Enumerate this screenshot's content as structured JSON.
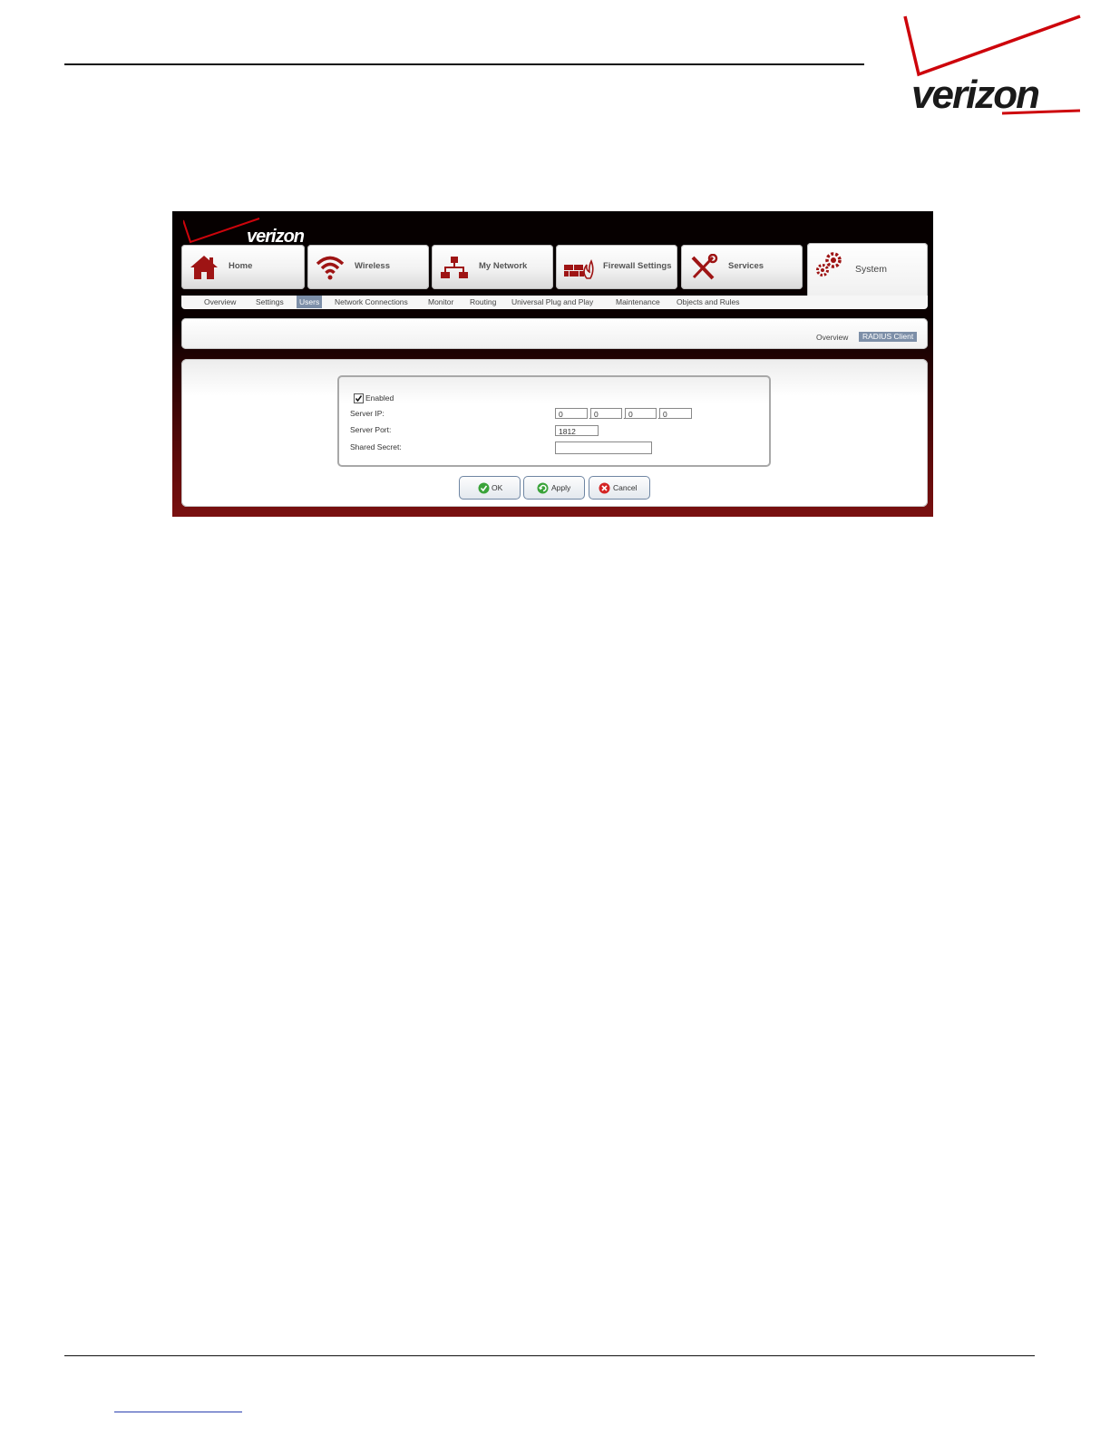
{
  "document": {
    "brand_logo_text": "verizon"
  },
  "router_ui": {
    "logo_text": "verizon",
    "main_tabs": [
      {
        "label": "Home",
        "icon": "home-icon"
      },
      {
        "label": "Wireless",
        "icon": "wireless-icon"
      },
      {
        "label": "My Network",
        "icon": "network-icon"
      },
      {
        "label": "Firewall Settings",
        "icon": "firewall-icon"
      },
      {
        "label": "Services",
        "icon": "tools-icon"
      },
      {
        "label": "System",
        "icon": "gears-icon",
        "active": true
      }
    ],
    "sub_nav": [
      {
        "label": "Overview"
      },
      {
        "label": "Settings"
      },
      {
        "label": "Users",
        "active": true
      },
      {
        "label": "Network Connections"
      },
      {
        "label": "Monitor"
      },
      {
        "label": "Routing"
      },
      {
        "label": "Universal Plug and Play"
      },
      {
        "label": "Maintenance"
      },
      {
        "label": "Objects and Rules"
      }
    ],
    "breadcrumbs": [
      {
        "label": "Overview"
      },
      {
        "label": "RADIUS Client",
        "active": true
      }
    ],
    "form": {
      "enabled_label": "Enabled",
      "enabled_checked": true,
      "server_ip_label": "Server IP:",
      "server_ip": [
        "0",
        "0",
        "0",
        "0"
      ],
      "server_port_label": "Server Port:",
      "server_port": "1812",
      "shared_secret_label": "Shared Secret:",
      "shared_secret": ""
    },
    "buttons": {
      "ok": "OK",
      "apply": "Apply",
      "cancel": "Cancel"
    },
    "colors": {
      "brand_red": "#cd040b",
      "tab_icon_red": "#9e1414",
      "selected_nav_bg": "#7d8fa8",
      "button_border": "#6f86a3"
    }
  }
}
